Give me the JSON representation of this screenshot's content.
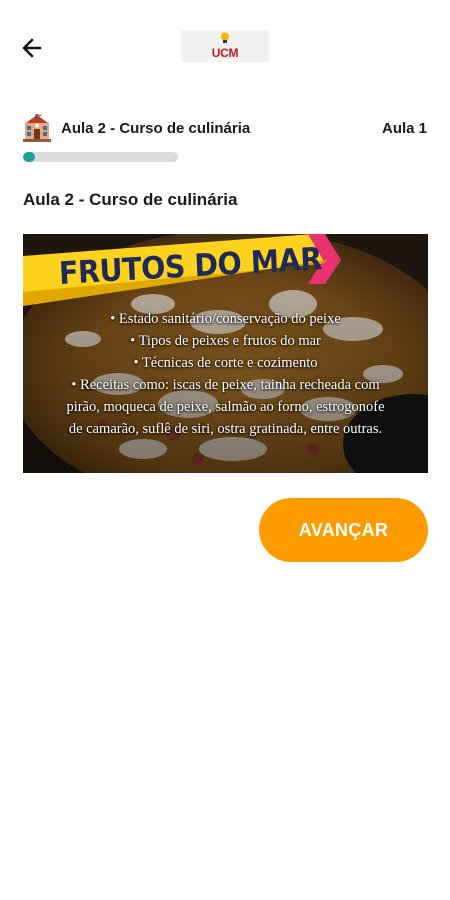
{
  "app": {
    "logo_text": "UCM"
  },
  "header": {
    "course_title": "Aula 2 - Curso de culinária",
    "lesson_counter": "Aula 1",
    "progress": 0.08
  },
  "lesson": {
    "title": "Aula 2 - Curso de culinária",
    "banner": {
      "heading": "FRUTOS DO MAR",
      "lines": [
        "• Estado sanitário/conservação do peixe",
        "• Tipos de peixes e frutos do mar",
        "• Técnicas de corte e cozimento",
        "• Receitas como: iscas de peixe, tainha recheada com",
        "pirão, moqueca de peixe, salmão ao forno, estrogonofe",
        "de camarão, suflê de siri, ostra gratinada, entre outras."
      ]
    }
  },
  "actions": {
    "advance_label": "AVANÇAR"
  },
  "colors": {
    "accent": "#ff9b00",
    "progress": "#1aa196",
    "track": "#dcdcdc",
    "banner_ribbon": "#ffd21e",
    "banner_ribbon_edge": "#e8336f"
  },
  "icons": {
    "back": "arrow-left-icon",
    "school": "school-building-icon"
  }
}
